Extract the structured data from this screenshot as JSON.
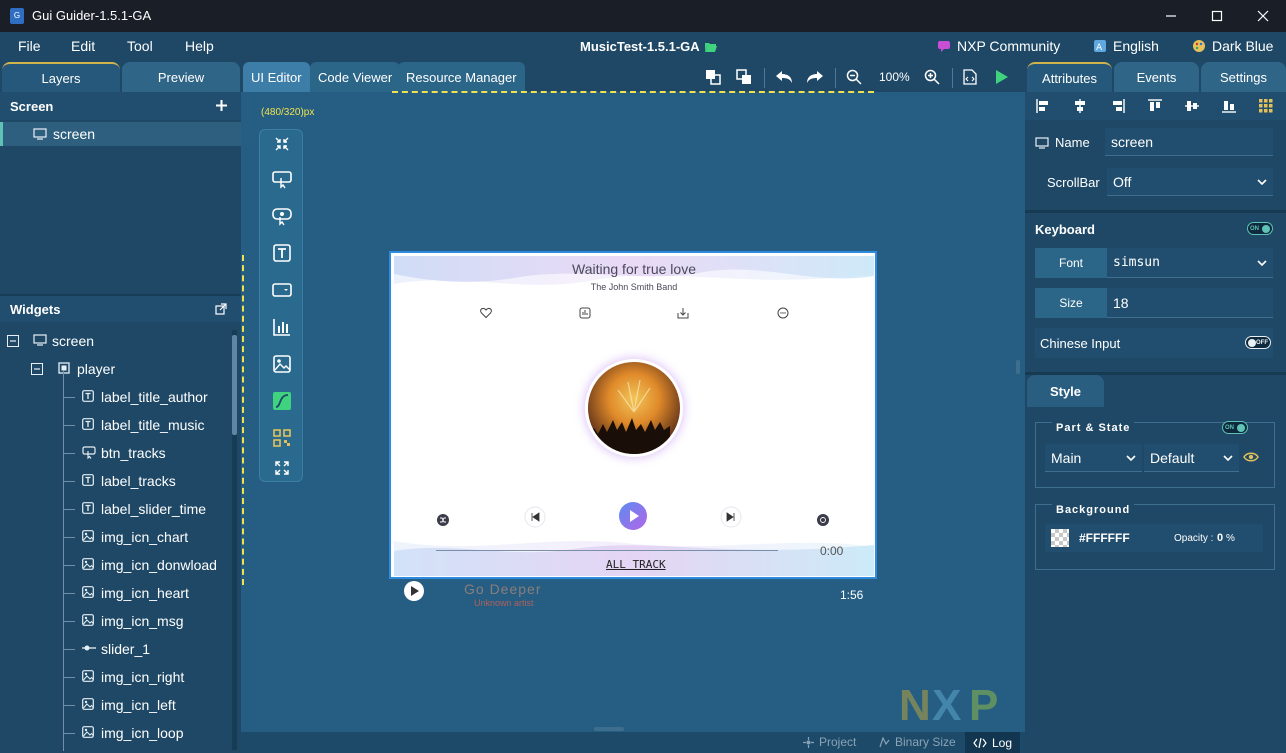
{
  "window": {
    "title": "Gui Guider-1.5.1-GA"
  },
  "menubar": {
    "items": [
      "File",
      "Edit",
      "Tool",
      "Help"
    ],
    "project": "MusicTest-1.5.1-GA",
    "community": "NXP Community",
    "language": "English",
    "theme": "Dark Blue"
  },
  "left": {
    "tabs": [
      "Layers",
      "Preview"
    ],
    "screen_header": "Screen",
    "screen_item": "screen",
    "widgets_header": "Widgets",
    "tree": [
      {
        "label": "screen",
        "icon": "monitor-icon",
        "level": 0
      },
      {
        "label": "player",
        "icon": "container-icon",
        "level": 1
      },
      {
        "label": "label_title_author",
        "icon": "label-icon",
        "level": 2
      },
      {
        "label": "label_title_music",
        "icon": "label-icon",
        "level": 2
      },
      {
        "label": "btn_tracks",
        "icon": "button-icon",
        "level": 2
      },
      {
        "label": "label_tracks",
        "icon": "label-icon",
        "level": 2
      },
      {
        "label": "label_slider_time",
        "icon": "label-icon",
        "level": 2
      },
      {
        "label": "img_icn_chart",
        "icon": "image-icon",
        "level": 2
      },
      {
        "label": "img_icn_donwload",
        "icon": "image-icon",
        "level": 2
      },
      {
        "label": "img_icn_heart",
        "icon": "image-icon",
        "level": 2
      },
      {
        "label": "img_icn_msg",
        "icon": "image-icon",
        "level": 2
      },
      {
        "label": "slider_1",
        "icon": "slider-icon",
        "level": 2
      },
      {
        "label": "img_icn_right",
        "icon": "image-icon",
        "level": 2
      },
      {
        "label": "img_icn_left",
        "icon": "image-icon",
        "level": 2
      },
      {
        "label": "img_icn_loop",
        "icon": "image-icon",
        "level": 2
      }
    ]
  },
  "center": {
    "tabs": [
      "UI Editor",
      "Code Viewer",
      "Resource Manager"
    ],
    "zoom": "100%",
    "canvas_size": "(480/320)px"
  },
  "player": {
    "title": "Waiting for true love",
    "author": "The John Smith Band",
    "time": "0:00",
    "tracks_label": "ALL TRACK",
    "below_title": "Go Deeper",
    "below_artist": "Unknown artist",
    "below_time": "1:56"
  },
  "status": {
    "project": "Project",
    "binary": "Binary Size",
    "log": "Log"
  },
  "right": {
    "tabs": [
      "Attributes",
      "Events",
      "Settings"
    ],
    "name_label": "Name",
    "name_value": "screen",
    "scrollbar_label": "ScrollBar",
    "scrollbar_value": "Off",
    "keyboard_label": "Keyboard",
    "keyboard_toggle": "ON",
    "font_label": "Font",
    "font_value": "simsun",
    "size_label": "Size",
    "size_value": "18",
    "chinese_label": "Chinese Input",
    "chinese_toggle": "OFF",
    "style_tab": "Style",
    "part_state_label": "Part & State",
    "part_state_toggle": "ON",
    "part_value": "Main",
    "state_value": "Default",
    "background_label": "Background",
    "bg_color": "#FFFFFF",
    "opacity_label": "Opacity :",
    "opacity_value": "0",
    "opacity_unit": "%"
  },
  "colors": {
    "accent": "#5ec3b5",
    "canvas_border": "#2f8be0",
    "ruler": "#f0e14e",
    "play_green": "#3fd27f"
  }
}
